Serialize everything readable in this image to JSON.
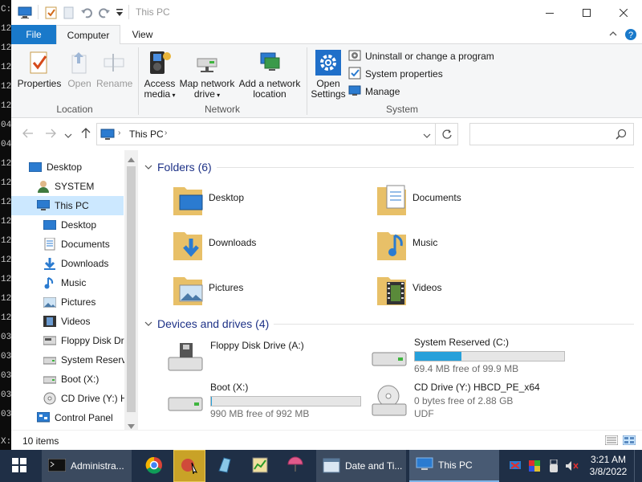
{
  "window": {
    "title": "This PC"
  },
  "console_lines": [
    "C:",
    "12",
    "12",
    "12",
    "12",
    "12",
    "04",
    "04",
    "12",
    "12",
    "12",
    "12",
    "12",
    "12",
    "12",
    "12",
    "12",
    "03",
    "03",
    "03",
    "03",
    "03"
  ],
  "console_bottom": "X:",
  "ribbon": {
    "tabs": [
      "File",
      "Computer",
      "View"
    ],
    "location": {
      "buttons": [
        "Properties",
        "Open",
        "Rename"
      ],
      "group_label": "Location"
    },
    "network": {
      "access_media": [
        "Access",
        "media"
      ],
      "map_drive": [
        "Map network",
        "drive"
      ],
      "add_location": [
        "Add a network",
        "location"
      ],
      "group_label": "Network"
    },
    "system": {
      "open_settings": [
        "Open",
        "Settings"
      ],
      "items": [
        "Uninstall or change a program",
        "System properties",
        "Manage"
      ],
      "group_label": "System"
    }
  },
  "address": {
    "path": "This PC",
    "search_placeholder": ""
  },
  "nav": {
    "items": [
      {
        "label": "Desktop",
        "icon": "desktop-icon"
      },
      {
        "label": "SYSTEM",
        "icon": "user-icon"
      },
      {
        "label": "This PC",
        "icon": "pc-icon",
        "selected": true
      },
      {
        "label": "Desktop",
        "icon": "desktop-icon"
      },
      {
        "label": "Documents",
        "icon": "documents-icon"
      },
      {
        "label": "Downloads",
        "icon": "downloads-icon"
      },
      {
        "label": "Music",
        "icon": "music-icon"
      },
      {
        "label": "Pictures",
        "icon": "pictures-icon"
      },
      {
        "label": "Videos",
        "icon": "videos-icon"
      },
      {
        "label": "Floppy Disk Dri",
        "icon": "floppy-icon"
      },
      {
        "label": "System Reserve",
        "icon": "drive-icon"
      },
      {
        "label": "Boot (X:)",
        "icon": "drive-icon"
      },
      {
        "label": "CD Drive (Y:) H",
        "icon": "cd-icon"
      },
      {
        "label": "Control Panel",
        "icon": "control-panel-icon"
      }
    ]
  },
  "folders": {
    "header": "Folders (6)",
    "items": [
      "Desktop",
      "Documents",
      "Downloads",
      "Music",
      "Pictures",
      "Videos"
    ]
  },
  "drives": {
    "header": "Devices and drives (4)",
    "items": [
      {
        "name": "Floppy Disk Drive (A:)",
        "free": "",
        "bar": false
      },
      {
        "name": "System Reserved (C:)",
        "free": "69.4 MB free of 99.9 MB",
        "bar": true,
        "used_fraction": 0.31
      },
      {
        "name": "Boot (X:)",
        "free": "990 MB free of 992 MB",
        "bar": true,
        "used_fraction": 0.002
      },
      {
        "name": "CD Drive (Y:) HBCD_PE_x64",
        "free": "0 bytes free of 2.88 GB",
        "fs": "UDF",
        "bar": false
      }
    ]
  },
  "status": {
    "count": "10 items"
  },
  "taskbar": {
    "admin_label": "Administra...",
    "datetime_label": "Date and Ti...",
    "thispc_label": "This PC",
    "time": "3:21 AM",
    "date": "3/8/2022"
  },
  "colors": {
    "accent": "#1979ca",
    "taskbar": "#1f2f46",
    "bar_fill": "#26a0da"
  }
}
